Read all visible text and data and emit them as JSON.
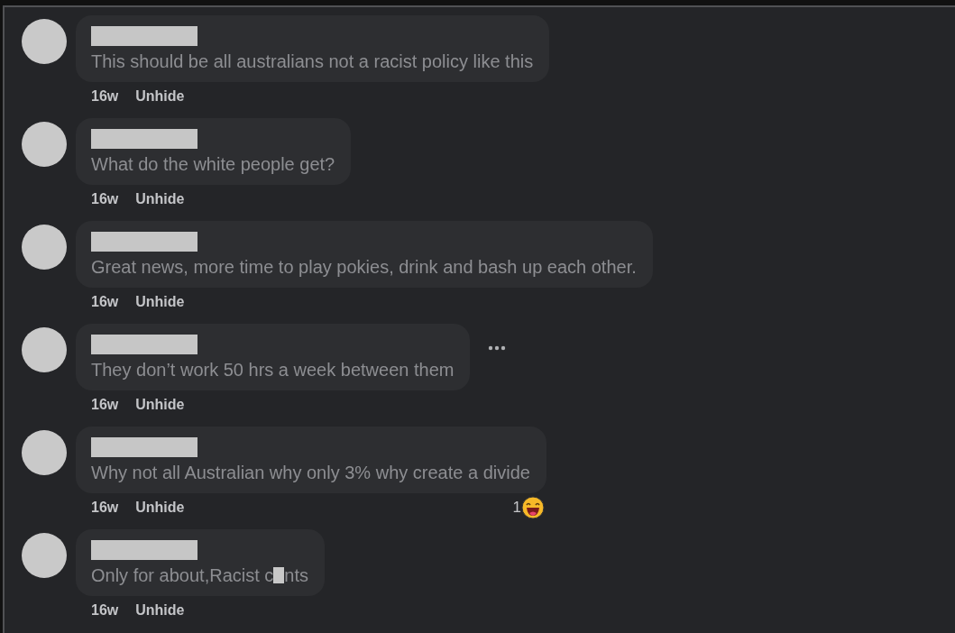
{
  "comments": [
    {
      "text": [
        {
          "kind": "text",
          "value": "This should be all australians not a racist policy like this"
        }
      ],
      "time": "16w",
      "action": "Unhide",
      "more_menu": false
    },
    {
      "text": [
        {
          "kind": "text",
          "value": "What do the white people get?"
        }
      ],
      "time": "16w",
      "action": "Unhide",
      "more_menu": false
    },
    {
      "text": [
        {
          "kind": "text",
          "value": "Great news, more time to play pokies, drink and bash up each other."
        }
      ],
      "time": "16w",
      "action": "Unhide",
      "more_menu": false
    },
    {
      "text": [
        {
          "kind": "text",
          "value": "They don’t work 50 hrs a week between them"
        }
      ],
      "time": "16w",
      "action": "Unhide",
      "more_menu": true
    },
    {
      "text": [
        {
          "kind": "text",
          "value": "Why not all Australian why only 3% why create a divide"
        }
      ],
      "time": "16w",
      "action": "Unhide",
      "more_menu": false,
      "reaction": {
        "count": "1"
      }
    },
    {
      "text": [
        {
          "kind": "text",
          "value": "Only for about,Racist c"
        },
        {
          "kind": "redaction"
        },
        {
          "kind": "text",
          "value": "nts"
        }
      ],
      "time": "16w",
      "action": "Unhide",
      "more_menu": false
    }
  ]
}
